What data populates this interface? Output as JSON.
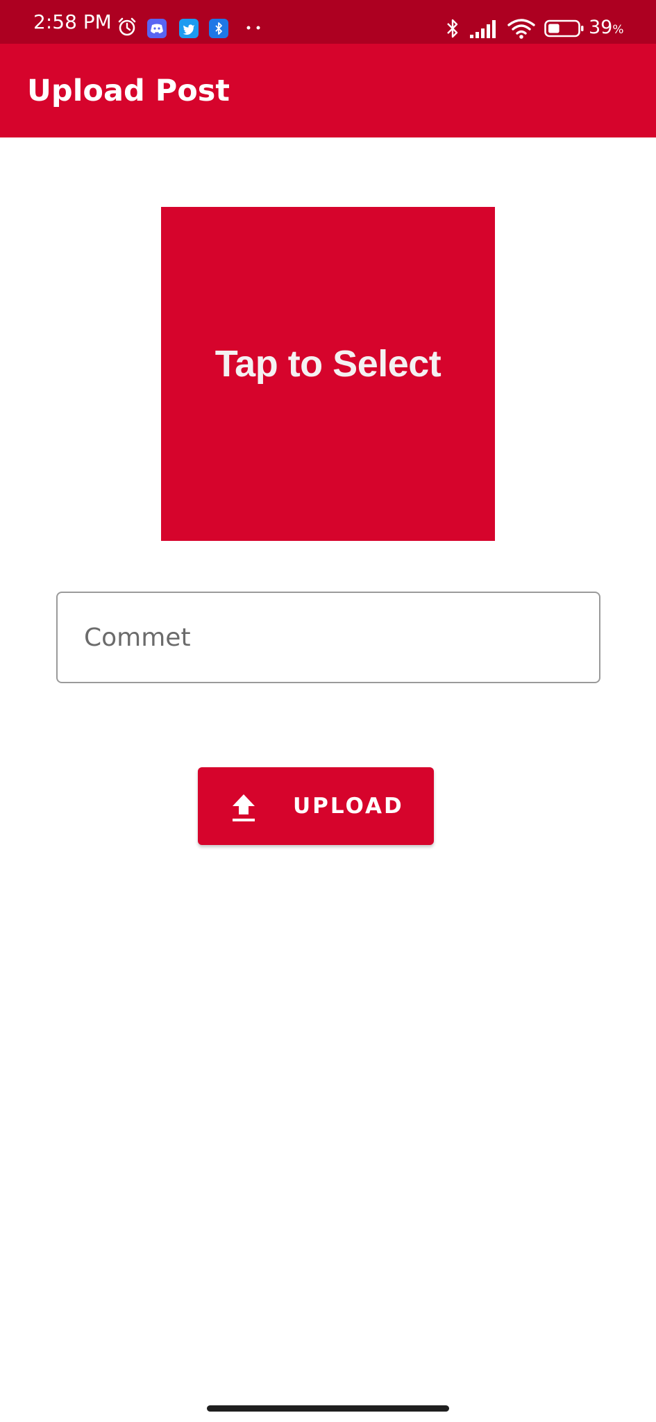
{
  "status_bar": {
    "time": "2:58 PM",
    "battery_percent": "39",
    "battery_unit": "%",
    "battery_level": 0.39,
    "icons": [
      "alarm-icon",
      "discord-icon",
      "twitter-icon",
      "bluetooth-app-icon",
      "more-dots-icon",
      "bluetooth-icon",
      "signal-icon",
      "wifi-icon",
      "battery-icon"
    ]
  },
  "app_bar": {
    "title": "Upload Post"
  },
  "image_picker": {
    "label": "Tap to Select"
  },
  "comment": {
    "placeholder": "Commet",
    "value": ""
  },
  "upload_button": {
    "label": "UPLOAD",
    "icon": "upload-icon"
  },
  "colors": {
    "status_bar": "#ad0021",
    "primary": "#d6042c",
    "on_primary": "#ffffff",
    "background": "#ffffff"
  }
}
